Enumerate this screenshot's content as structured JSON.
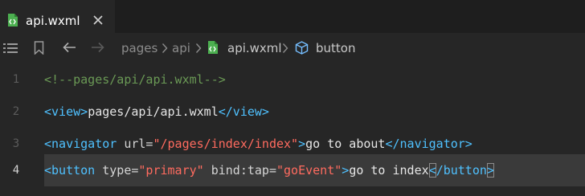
{
  "tab": {
    "label": "api.wxml",
    "file_icon": "wxml-file-icon",
    "close_icon": "close-icon",
    "accent_color": "#4caf50"
  },
  "breadcrumb": {
    "items": [
      "pages",
      "api",
      "api.wxml",
      "button"
    ],
    "icons": [
      "list-icon",
      "bookmark-icon",
      "back-arrow-icon",
      "forward-arrow-icon"
    ]
  },
  "editor": {
    "active_line": 4,
    "lines": [
      {
        "number": "1",
        "tokens": [
          {
            "cls": "c-comment",
            "text": "<!--pages/api/api.wxml-->"
          }
        ]
      },
      {
        "number": "2",
        "tokens": [
          {
            "cls": "c-tag",
            "text": "<view>"
          },
          {
            "cls": "c-text",
            "text": "pages/api/api.wxml"
          },
          {
            "cls": "c-tag",
            "text": "</view>"
          }
        ]
      },
      {
        "number": "3",
        "tokens": [
          {
            "cls": "c-tag",
            "text": "<navigator"
          },
          {
            "cls": "c-attr",
            "text": " url="
          },
          {
            "cls": "c-str",
            "text": "\"/pages/index/index\""
          },
          {
            "cls": "c-tag",
            "text": ">"
          },
          {
            "cls": "c-text",
            "text": "go to about"
          },
          {
            "cls": "c-tag",
            "text": "</navigator>"
          }
        ]
      },
      {
        "number": "4",
        "tokens": [
          {
            "cls": "c-tag",
            "text": "<button"
          },
          {
            "cls": "c-attr",
            "text": " type="
          },
          {
            "cls": "c-str",
            "text": "\"primary\""
          },
          {
            "cls": "c-attr",
            "text": " bind:tap="
          },
          {
            "cls": "c-str",
            "text": "\"goEvent\""
          },
          {
            "cls": "c-tag",
            "text": ">"
          },
          {
            "cls": "c-text",
            "text": "go to index"
          },
          {
            "cls": "c-tag c-bracket-box",
            "text": "<"
          },
          {
            "cls": "c-tag",
            "text": "/button"
          },
          {
            "cls": "c-tag c-bracket-box",
            "text": ">"
          }
        ]
      }
    ]
  }
}
